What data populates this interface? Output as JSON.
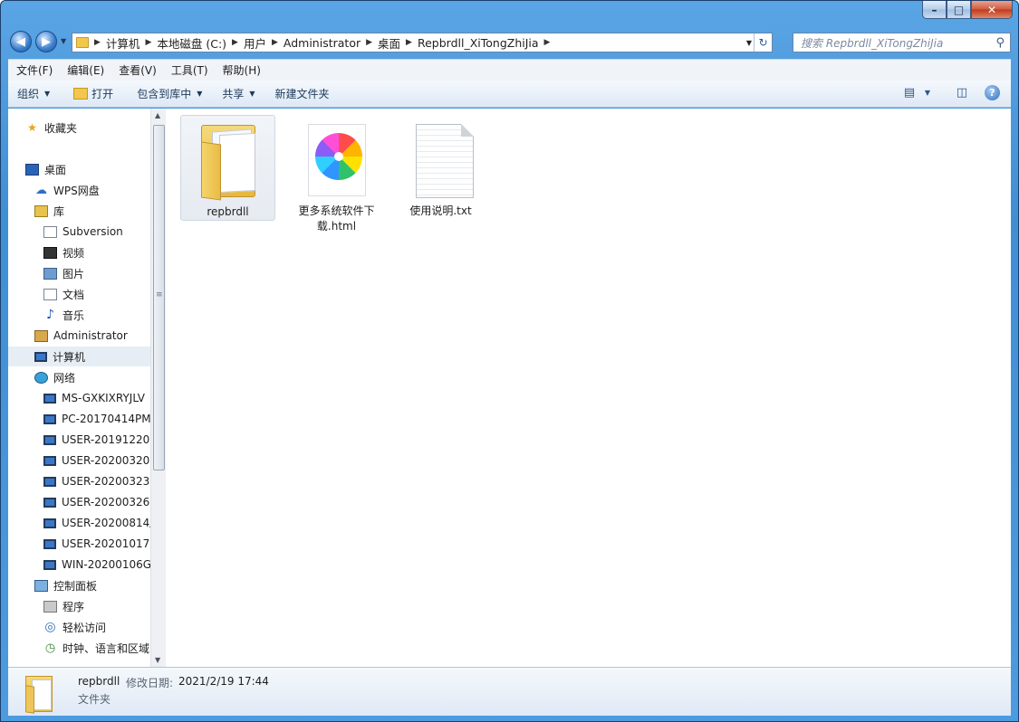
{
  "window": {
    "caption_buttons": {
      "minimize": "–",
      "maximize": "□",
      "close": "✕"
    }
  },
  "nav": {
    "back_icon": "back-arrow-icon",
    "forward_icon": "forward-arrow-icon",
    "breadcrumb": [
      "计算机",
      "本地磁盘 (C:)",
      "用户",
      "Administrator",
      "桌面",
      "Repbrdll_XiTongZhiJia"
    ],
    "search_placeholder": "搜索 Repbrdll_XiTongZhiJia"
  },
  "menu": [
    "文件(F)",
    "编辑(E)",
    "查看(V)",
    "工具(T)",
    "帮助(H)"
  ],
  "toolbar": {
    "organize": "组织",
    "open": "打开",
    "include_library": "包含到库中",
    "share": "共享",
    "new_folder": "新建文件夹",
    "help": "?"
  },
  "sidebar": {
    "items": [
      {
        "label": "收藏夹",
        "icon": "favorites-star-icon"
      },
      {
        "label": "桌面",
        "icon": "desktop-icon"
      },
      {
        "label": "WPS网盘",
        "icon": "wps-cloud-icon"
      },
      {
        "label": "库",
        "icon": "library-icon"
      },
      {
        "label": "Subversion",
        "icon": "subversion-library-icon"
      },
      {
        "label": "视频",
        "icon": "video-library-icon"
      },
      {
        "label": "图片",
        "icon": "pictures-library-icon"
      },
      {
        "label": "文档",
        "icon": "documents-library-icon"
      },
      {
        "label": "音乐",
        "icon": "music-library-icon"
      },
      {
        "label": "Administrator",
        "icon": "user-folder-icon"
      },
      {
        "label": "计算机",
        "icon": "computer-icon"
      },
      {
        "label": "网络",
        "icon": "network-icon"
      },
      {
        "label": "MS-GXKIXRYJLV",
        "icon": "network-computer-icon"
      },
      {
        "label": "PC-20170414PM",
        "icon": "network-computer-icon"
      },
      {
        "label": "USER-20191220I",
        "icon": "network-computer-icon"
      },
      {
        "label": "USER-20200320(",
        "icon": "network-computer-icon"
      },
      {
        "label": "USER-20200323'",
        "icon": "network-computer-icon"
      },
      {
        "label": "USER-20200326'",
        "icon": "network-computer-icon"
      },
      {
        "label": "USER-20200814/",
        "icon": "network-computer-icon"
      },
      {
        "label": "USER-20201017I",
        "icon": "network-computer-icon"
      },
      {
        "label": "WIN-20200106G",
        "icon": "network-computer-icon"
      },
      {
        "label": "控制面板",
        "icon": "control-panel-icon"
      },
      {
        "label": "程序",
        "icon": "programs-icon"
      },
      {
        "label": "轻松访问",
        "icon": "ease-of-access-icon"
      },
      {
        "label": "时钟、语言和区域",
        "icon": "clock-language-icon"
      }
    ]
  },
  "files": [
    {
      "name": "repbrdll",
      "type": "folder",
      "selected": true
    },
    {
      "name": "更多系统软件下载.html",
      "type": "html"
    },
    {
      "name": "使用说明.txt",
      "type": "txt"
    }
  ],
  "details": {
    "name": "repbrdll",
    "modified_label": "修改日期:",
    "modified_value": "2021/2/19 17:44",
    "type": "文件夹"
  }
}
